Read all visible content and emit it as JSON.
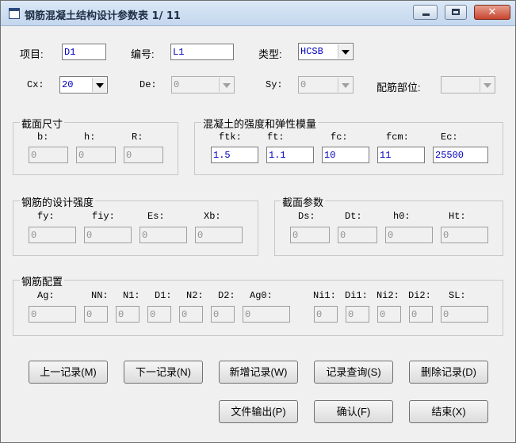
{
  "window": {
    "title": "钢筋混凝土结构设计参数表 1/ 11",
    "close_glyph": "✕"
  },
  "header": {
    "xiangmu": {
      "label": "项目:",
      "value": "D1"
    },
    "bianhao": {
      "label": "编号:",
      "value": "L1"
    },
    "leixing": {
      "label": "类型:",
      "value": "HCSB"
    },
    "cx": {
      "label": "Cx:",
      "value": "20"
    },
    "de": {
      "label": "De:",
      "value": "0"
    },
    "sy": {
      "label": "Sy:",
      "value": "0"
    },
    "peijin_buwei": {
      "label": "配筋部位:",
      "value": ""
    }
  },
  "section_size": {
    "title": "截面尺寸",
    "fields": [
      {
        "label": "b:",
        "value": "0"
      },
      {
        "label": "h:",
        "value": "0"
      },
      {
        "label": "R:",
        "value": "0"
      }
    ]
  },
  "concrete": {
    "title": "混凝土的强度和弹性模量",
    "fields": [
      {
        "label": "ftk:",
        "value": "1.5"
      },
      {
        "label": "ft:",
        "value": "1.1"
      },
      {
        "label": "fc:",
        "value": "10"
      },
      {
        "label": "fcm:",
        "value": "11"
      },
      {
        "label": "Ec:",
        "value": "25500"
      }
    ]
  },
  "steel_strength": {
    "title": "钢筋的设计强度",
    "fields": [
      {
        "label": "fy:",
        "value": "0"
      },
      {
        "label": "fiy:",
        "value": "0"
      },
      {
        "label": "Es:",
        "value": "0"
      },
      {
        "label": "Xb:",
        "value": "0"
      }
    ]
  },
  "section_params": {
    "title": "截面参数",
    "fields": [
      {
        "label": "Ds:",
        "value": "0"
      },
      {
        "label": "Dt:",
        "value": "0"
      },
      {
        "label": "h0:",
        "value": "0"
      },
      {
        "label": "Ht:",
        "value": "0"
      }
    ]
  },
  "rebar_config": {
    "title": "钢筋配置",
    "fields": [
      {
        "label": "Ag:",
        "value": "0"
      },
      {
        "label": "NN:",
        "value": "0"
      },
      {
        "label": "N1:",
        "value": "0"
      },
      {
        "label": "D1:",
        "value": "0"
      },
      {
        "label": "N2:",
        "value": "0"
      },
      {
        "label": "D2:",
        "value": "0"
      },
      {
        "label": "Ag0:",
        "value": "0"
      },
      {
        "label": "Ni1:",
        "value": "0"
      },
      {
        "label": "Di1:",
        "value": "0"
      },
      {
        "label": "Ni2:",
        "value": "0"
      },
      {
        "label": "Di2:",
        "value": "0"
      },
      {
        "label": "SL:",
        "value": "0"
      }
    ]
  },
  "buttons": {
    "prev": "上一记录(M)",
    "next": "下一记录(N)",
    "add": "新增记录(W)",
    "query": "记录查询(S)",
    "delete": "删除记录(D)",
    "export": "文件输出(P)",
    "confirm": "确认(F)",
    "end": "结束(X)"
  }
}
